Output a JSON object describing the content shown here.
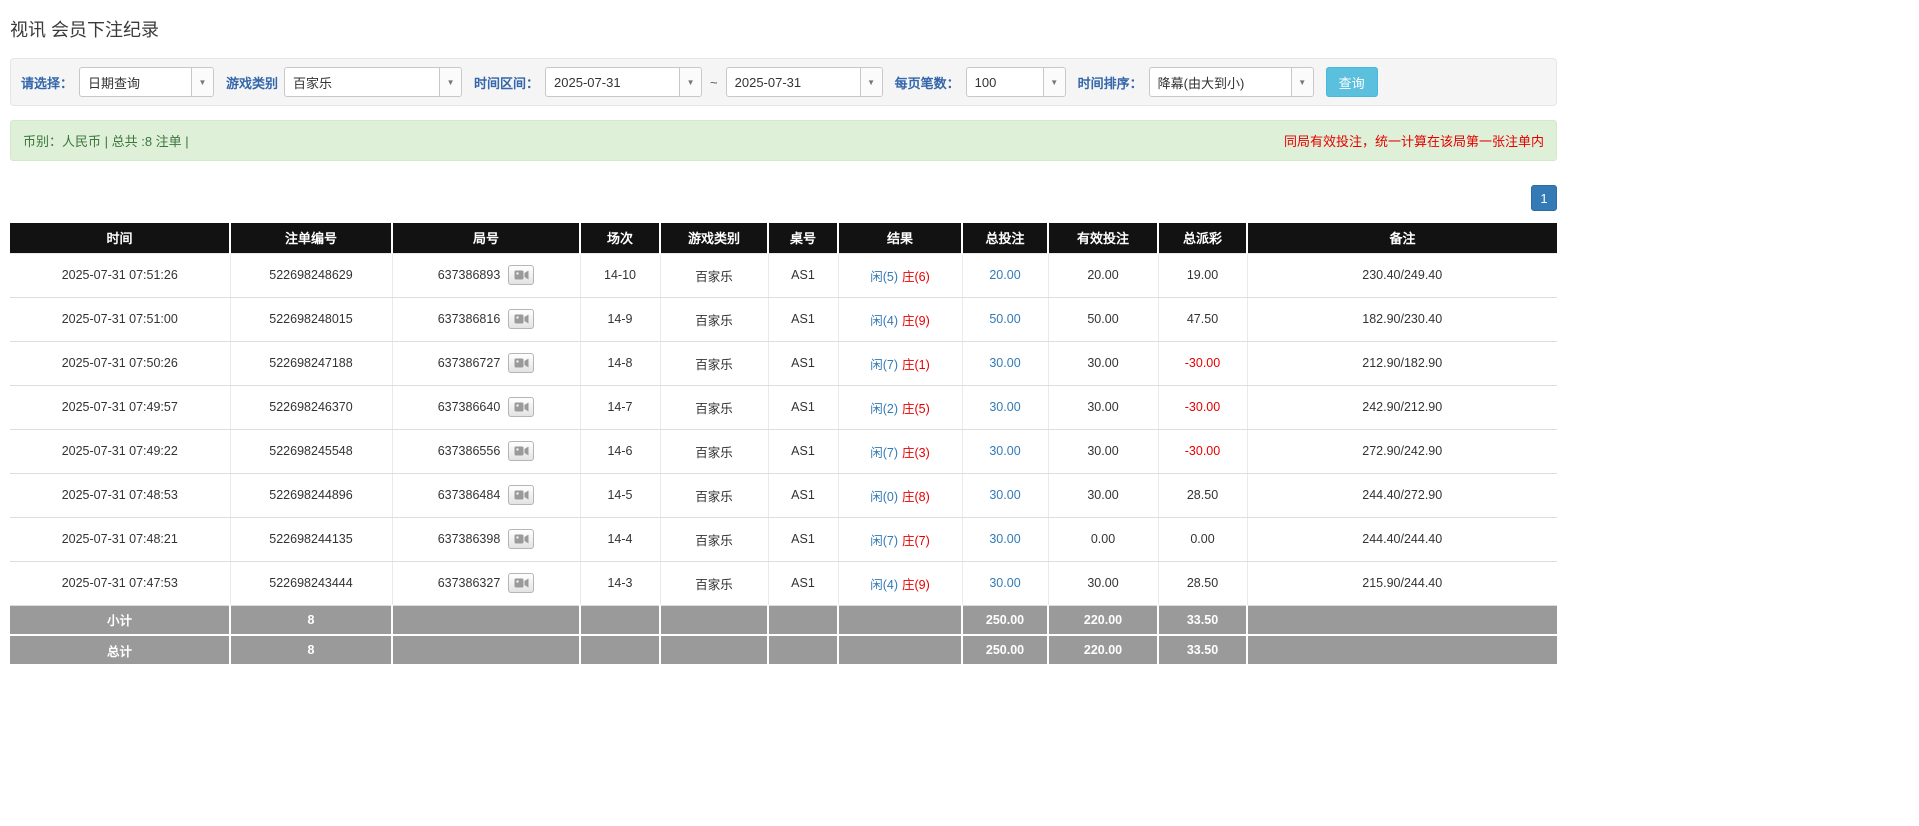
{
  "page": {
    "title": "视讯 会员下注纪录"
  },
  "colors": {
    "label-blue": "#3366aa",
    "accent-blue": "#5bc0de",
    "link-blue": "#337ab7",
    "player-blue": "#337ab7",
    "banker-red": "#e60000",
    "negative-red": "#e60000",
    "notice-red": "#e60000",
    "summary-green": "#dff0d8",
    "summary-text": "#3c763d",
    "header-bg": "#121212",
    "summary-gray": "#9a9a9a"
  },
  "filters": {
    "select_label": "请选择：",
    "select_value": "日期查询",
    "game_label": "游戏类别",
    "game_value": "百家乐",
    "range_label": "时间区间：",
    "date_from": "2025-07-31",
    "range_separator": "~",
    "date_to": "2025-07-31",
    "per_page_label": "每页笔数：",
    "per_page_value": "100",
    "sort_label": "时间排序：",
    "sort_value": "降幕(由大到小)",
    "search_button": "查询",
    "caret_icon": "▼"
  },
  "summary": {
    "left": "币别：人民币 | 总共 :8 注单 |",
    "right": "同局有效投注，统一计算在该局第一张注单内"
  },
  "pagination": {
    "current": "1"
  },
  "table": {
    "headers": [
      "时间",
      "注单编号",
      "局号",
      "场次",
      "游戏类别",
      "桌号",
      "结果",
      "总投注",
      "有效投注",
      "总派彩",
      "备注"
    ],
    "rows": [
      {
        "time": "2025-07-31 07:51:26",
        "bet_id": "522698248629",
        "round_id": "637386893",
        "session": "14-10",
        "game_type": "百家乐",
        "table_no": "AS1",
        "result_player": "闲(5)",
        "result_banker": "庄(6)",
        "total_bet": "20.00",
        "valid_bet": "20.00",
        "payout": "19.00",
        "note": "230.40/249.40"
      },
      {
        "time": "2025-07-31 07:51:00",
        "bet_id": "522698248015",
        "round_id": "637386816",
        "session": "14-9",
        "game_type": "百家乐",
        "table_no": "AS1",
        "result_player": "闲(4)",
        "result_banker": "庄(9)",
        "total_bet": "50.00",
        "valid_bet": "50.00",
        "payout": "47.50",
        "note": "182.90/230.40"
      },
      {
        "time": "2025-07-31 07:50:26",
        "bet_id": "522698247188",
        "round_id": "637386727",
        "session": "14-8",
        "game_type": "百家乐",
        "table_no": "AS1",
        "result_player": "闲(7)",
        "result_banker": "庄(1)",
        "total_bet": "30.00",
        "valid_bet": "30.00",
        "payout": "-30.00",
        "note": "212.90/182.90"
      },
      {
        "time": "2025-07-31 07:49:57",
        "bet_id": "522698246370",
        "round_id": "637386640",
        "session": "14-7",
        "game_type": "百家乐",
        "table_no": "AS1",
        "result_player": "闲(2)",
        "result_banker": "庄(5)",
        "total_bet": "30.00",
        "valid_bet": "30.00",
        "payout": "-30.00",
        "note": "242.90/212.90"
      },
      {
        "time": "2025-07-31 07:49:22",
        "bet_id": "522698245548",
        "round_id": "637386556",
        "session": "14-6",
        "game_type": "百家乐",
        "table_no": "AS1",
        "result_player": "闲(7)",
        "result_banker": "庄(3)",
        "total_bet": "30.00",
        "valid_bet": "30.00",
        "payout": "-30.00",
        "note": "272.90/242.90"
      },
      {
        "time": "2025-07-31 07:48:53",
        "bet_id": "522698244896",
        "round_id": "637386484",
        "session": "14-5",
        "game_type": "百家乐",
        "table_no": "AS1",
        "result_player": "闲(0)",
        "result_banker": "庄(8)",
        "total_bet": "30.00",
        "valid_bet": "30.00",
        "payout": "28.50",
        "note": "244.40/272.90"
      },
      {
        "time": "2025-07-31 07:48:21",
        "bet_id": "522698244135",
        "round_id": "637386398",
        "session": "14-4",
        "game_type": "百家乐",
        "table_no": "AS1",
        "result_player": "闲(7)",
        "result_banker": "庄(7)",
        "total_bet": "30.00",
        "valid_bet": "0.00",
        "payout": "0.00",
        "note": "244.40/244.40"
      },
      {
        "time": "2025-07-31 07:47:53",
        "bet_id": "522698243444",
        "round_id": "637386327",
        "session": "14-3",
        "game_type": "百家乐",
        "table_no": "AS1",
        "result_player": "闲(4)",
        "result_banker": "庄(9)",
        "total_bet": "30.00",
        "valid_bet": "30.00",
        "payout": "28.50",
        "note": "215.90/244.40"
      }
    ],
    "subtotal": {
      "label": "小计",
      "count": "8",
      "total_bet": "250.00",
      "valid_bet": "220.00",
      "payout": "33.50"
    },
    "total": {
      "label": "总计",
      "count": "8",
      "total_bet": "250.00",
      "valid_bet": "220.00",
      "payout": "33.50"
    }
  }
}
